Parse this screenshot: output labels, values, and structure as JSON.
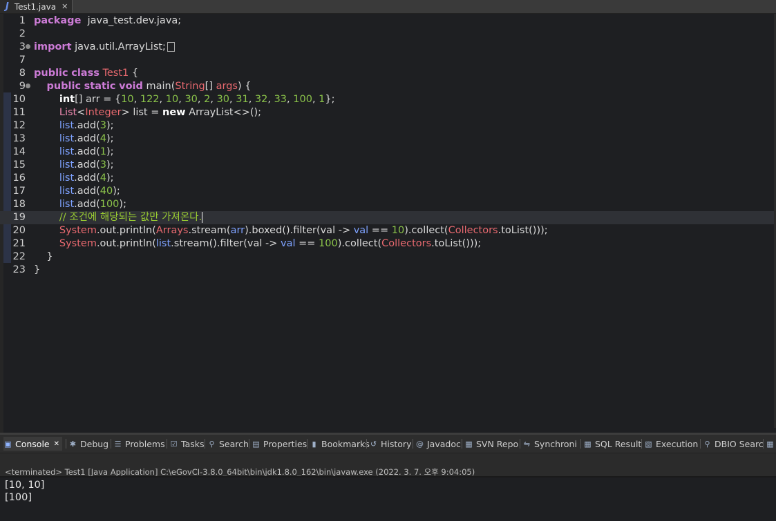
{
  "editor_tab": {
    "icon": "J",
    "title": "Test1.java",
    "close": "✕"
  },
  "code_lines": [
    {
      "n": "1",
      "parts": [
        [
          "kw",
          "package"
        ],
        [
          "",
          "  java_test.dev.java;"
        ]
      ]
    },
    {
      "n": "2",
      "parts": []
    },
    {
      "n": "3",
      "parts": [
        [
          "kw",
          "import"
        ],
        [
          "",
          " java.util.ArrayList;"
        ]
      ],
      "collapsed": true
    },
    {
      "n": "7",
      "parts": []
    },
    {
      "n": "8",
      "parts": [
        [
          "kw",
          "public"
        ],
        [
          "",
          " "
        ],
        [
          "kw",
          "class"
        ],
        [
          "",
          " "
        ],
        [
          "cls",
          "Test1"
        ],
        [
          "",
          " {"
        ]
      ]
    },
    {
      "n": "9",
      "parts": [
        [
          "",
          "    "
        ],
        [
          "kw",
          "public"
        ],
        [
          "",
          " "
        ],
        [
          "kw",
          "static"
        ],
        [
          "",
          " "
        ],
        [
          "kw",
          "void"
        ],
        [
          "",
          " main("
        ],
        [
          "cls",
          "String"
        ],
        [
          "",
          "[] "
        ],
        [
          "cls",
          "args"
        ],
        [
          "",
          ") {"
        ]
      ]
    },
    {
      "n": "10",
      "parts": [
        [
          "",
          "        "
        ],
        [
          "kw2",
          "int"
        ],
        [
          "",
          "[] arr = {"
        ],
        [
          "num",
          "10"
        ],
        [
          "",
          ", "
        ],
        [
          "num",
          "122"
        ],
        [
          "",
          ", "
        ],
        [
          "num",
          "10"
        ],
        [
          "",
          ", "
        ],
        [
          "num",
          "30"
        ],
        [
          "",
          ", "
        ],
        [
          "num",
          "2"
        ],
        [
          "",
          ", "
        ],
        [
          "num",
          "30"
        ],
        [
          "",
          ", "
        ],
        [
          "num",
          "31"
        ],
        [
          "",
          ", "
        ],
        [
          "num",
          "32"
        ],
        [
          "",
          ", "
        ],
        [
          "num",
          "33"
        ],
        [
          "",
          ", "
        ],
        [
          "num",
          "100"
        ],
        [
          "",
          ", "
        ],
        [
          "num",
          "1"
        ],
        [
          "",
          "};"
        ]
      ]
    },
    {
      "n": "11",
      "parts": [
        [
          "",
          "        "
        ],
        [
          "typ",
          "List"
        ],
        [
          "",
          "<"
        ],
        [
          "cls",
          "Integer"
        ],
        [
          "",
          "> list = "
        ],
        [
          "kw2",
          "new"
        ],
        [
          "",
          " ArrayList<>();"
        ]
      ]
    },
    {
      "n": "12",
      "parts": [
        [
          "",
          "        "
        ],
        [
          "fld",
          "list"
        ],
        [
          "",
          ".add("
        ],
        [
          "num",
          "3"
        ],
        [
          "",
          ");"
        ]
      ]
    },
    {
      "n": "13",
      "parts": [
        [
          "",
          "        "
        ],
        [
          "fld",
          "list"
        ],
        [
          "",
          ".add("
        ],
        [
          "num",
          "4"
        ],
        [
          "",
          ");"
        ]
      ]
    },
    {
      "n": "14",
      "parts": [
        [
          "",
          "        "
        ],
        [
          "fld",
          "list"
        ],
        [
          "",
          ".add("
        ],
        [
          "num",
          "1"
        ],
        [
          "",
          ");"
        ]
      ]
    },
    {
      "n": "15",
      "parts": [
        [
          "",
          "        "
        ],
        [
          "fld",
          "list"
        ],
        [
          "",
          ".add("
        ],
        [
          "num",
          "3"
        ],
        [
          "",
          ");"
        ]
      ]
    },
    {
      "n": "16",
      "parts": [
        [
          "",
          "        "
        ],
        [
          "fld",
          "list"
        ],
        [
          "",
          ".add("
        ],
        [
          "num",
          "4"
        ],
        [
          "",
          ");"
        ]
      ]
    },
    {
      "n": "17",
      "parts": [
        [
          "",
          "        "
        ],
        [
          "fld",
          "list"
        ],
        [
          "",
          ".add("
        ],
        [
          "num",
          "40"
        ],
        [
          "",
          ");"
        ]
      ]
    },
    {
      "n": "18",
      "parts": [
        [
          "",
          "        "
        ],
        [
          "fld",
          "list"
        ],
        [
          "",
          ".add("
        ],
        [
          "num",
          "100"
        ],
        [
          "",
          ");"
        ]
      ]
    },
    {
      "n": "19",
      "parts": [
        [
          "",
          "        "
        ],
        [
          "cmt",
          "// 조건에 해당되는 값만 가져온다."
        ]
      ],
      "current": true
    },
    {
      "n": "20",
      "parts": [
        [
          "",
          "        "
        ],
        [
          "cls",
          "System"
        ],
        [
          "",
          ".out.println("
        ],
        [
          "cls",
          "Arrays"
        ],
        [
          "",
          ".stream("
        ],
        [
          "fld",
          "arr"
        ],
        [
          "",
          ").boxed().filter(val -> "
        ],
        [
          "fld",
          "val"
        ],
        [
          "",
          " == "
        ],
        [
          "num",
          "10"
        ],
        [
          "",
          ").collect("
        ],
        [
          "cls",
          "Collectors"
        ],
        [
          "",
          ".toList()));"
        ]
      ]
    },
    {
      "n": "21",
      "parts": [
        [
          "",
          "        "
        ],
        [
          "cls",
          "System"
        ],
        [
          "",
          ".out.println("
        ],
        [
          "fld",
          "list"
        ],
        [
          "",
          ".stream().filter(val -> "
        ],
        [
          "fld",
          "val"
        ],
        [
          "",
          " == "
        ],
        [
          "num",
          "100"
        ],
        [
          "",
          ").collect("
        ],
        [
          "cls",
          "Collectors"
        ],
        [
          "",
          ".toList()));"
        ]
      ]
    },
    {
      "n": "22",
      "parts": [
        [
          "",
          "    }"
        ]
      ]
    },
    {
      "n": "23",
      "parts": [
        [
          "",
          "}"
        ]
      ]
    }
  ],
  "view_tabs": [
    {
      "icon": "monitor-icon",
      "glyph": "▣",
      "label": "Console",
      "close": "✕",
      "active": true
    },
    {
      "icon": "bug-icon",
      "glyph": "✱",
      "label": "Debug"
    },
    {
      "icon": "problems-icon",
      "glyph": "☰",
      "label": "Problems"
    },
    {
      "icon": "tasks-icon",
      "glyph": "☑",
      "label": "Tasks"
    },
    {
      "icon": "search-icon",
      "glyph": "⚲",
      "label": "Search"
    },
    {
      "icon": "properties-icon",
      "glyph": "▤",
      "label": "Properties"
    },
    {
      "icon": "bookmark-icon",
      "glyph": "▮",
      "label": "Bookmarks"
    },
    {
      "icon": "history-icon",
      "glyph": "↺",
      "label": "History"
    },
    {
      "icon": "javadoc-icon",
      "glyph": "@",
      "label": "Javadoc"
    },
    {
      "icon": "svn-icon",
      "glyph": "▦",
      "label": "SVN Repo"
    },
    {
      "icon": "synchronize-icon",
      "glyph": "⇋",
      "label": "Synchroni"
    },
    {
      "icon": "table-icon",
      "glyph": "▦",
      "label": "SQL Result"
    },
    {
      "icon": "execution-icon",
      "glyph": "▧",
      "label": "Execution"
    },
    {
      "icon": "dbio-search-icon",
      "glyph": "⚲",
      "label": "DBIO Searc"
    },
    {
      "icon": "more-icon",
      "glyph": "▦",
      "label": ""
    }
  ],
  "console": {
    "status": "<terminated> Test1 [Java Application] C:\\eGovCI-3.8.0_64bit\\bin\\jdk1.8.0_162\\bin\\javaw.exe  (2022. 3. 7. 오후 9:04:05)",
    "output": [
      "[10, 10]",
      "[100]"
    ]
  }
}
